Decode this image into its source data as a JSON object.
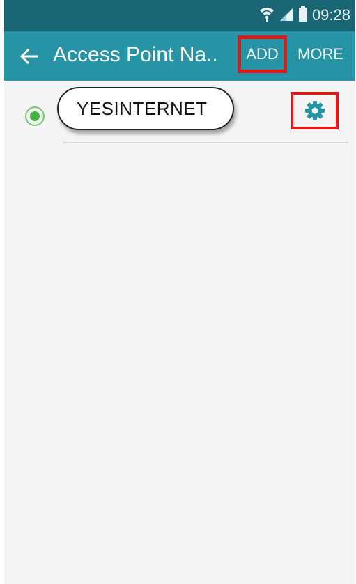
{
  "status_bar": {
    "time": "09:28",
    "icons": [
      "wifi-icon",
      "signal-icon",
      "battery-icon"
    ]
  },
  "toolbar": {
    "title": "Access Point Na..",
    "add_label": "ADD",
    "more_label": "MORE",
    "back_icon": "back-arrow-icon"
  },
  "apn_list": {
    "items": [
      {
        "name": "YESINTERNET",
        "selected": true,
        "settings_icon": "gear-icon"
      }
    ]
  },
  "colors": {
    "status_bar_bg": "#1b6673",
    "toolbar_bg": "#2794a6",
    "highlight_box": "#e01818",
    "radio_selected": "#46b146",
    "gear": "#2794a6",
    "screen_bg": "#f4f4f4"
  }
}
